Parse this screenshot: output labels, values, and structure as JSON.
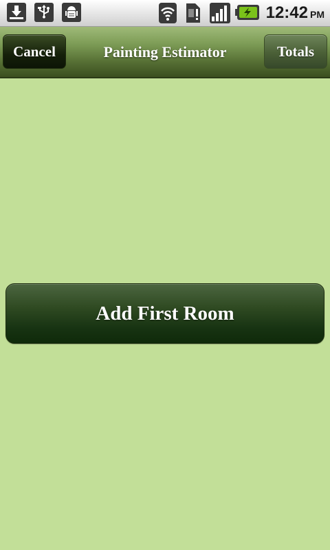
{
  "status_bar": {
    "icons": [
      "download-icon",
      "usb-icon",
      "android-debug-icon",
      "wifi-icon",
      "sim-alert-icon",
      "signal-icon",
      "battery-charging-icon"
    ],
    "time": "12:42",
    "ampm": "PM",
    "battery_color": "#7bc21a"
  },
  "header": {
    "cancel_label": "Cancel",
    "title": "Painting Estimator",
    "totals_label": "Totals"
  },
  "main": {
    "add_first_room_label": "Add First Room"
  },
  "colors": {
    "background": "#c2df98",
    "header_top": "#9fba78",
    "header_bottom": "#3b4f1f",
    "button_dark": "#0f2a0a"
  }
}
